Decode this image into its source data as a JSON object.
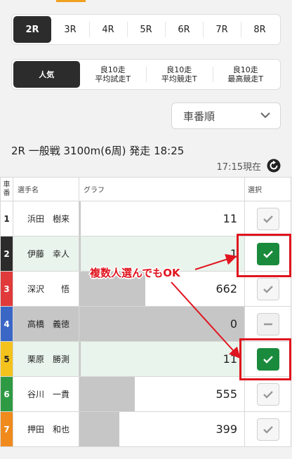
{
  "race_tabs": [
    {
      "label": "2R",
      "active": true
    },
    {
      "label": "3R"
    },
    {
      "label": "4R"
    },
    {
      "label": "5R"
    },
    {
      "label": "6R"
    },
    {
      "label": "7R"
    },
    {
      "label": "8R"
    }
  ],
  "sort_tabs": [
    {
      "label": "人気",
      "active": true
    },
    {
      "label": "良10走\n平均試走T"
    },
    {
      "label": "良10走\n平均競走T"
    },
    {
      "label": "良10走\n最高競走T"
    }
  ],
  "sort_select": {
    "value": "車番順"
  },
  "race_info": "2R 一般戦 3100m(6周) 発走 18:25",
  "now_label": "17:15現在",
  "table": {
    "headers": {
      "car": "車\n番",
      "rider": "選手名",
      "graph": "グラフ",
      "select": "選択"
    },
    "max_value": 662,
    "rows": [
      {
        "num": "1",
        "name": "浜田　樹来",
        "value": 11,
        "display": "11",
        "state": "unchecked",
        "color": "#ffffff",
        "num_color": "#222222"
      },
      {
        "num": "2",
        "name": "伊藤　幸人",
        "value": 1,
        "display": "1",
        "state": "checked",
        "color": "#2b2b2b",
        "num_color": "#ffffff"
      },
      {
        "num": "3",
        "name": "深沢　　悟",
        "value": 662,
        "display": "662",
        "state": "unchecked",
        "color": "#e03a3a",
        "num_color": "#ffffff"
      },
      {
        "num": "4",
        "name": "高橋　義徳",
        "value": 0,
        "display": "0",
        "state": "disabled",
        "color": "#3a66c6",
        "num_color": "#ffffff"
      },
      {
        "num": "5",
        "name": "栗原　勝測",
        "value": 11,
        "display": "11",
        "state": "checked",
        "color": "#f3c21c",
        "num_color": "#222222"
      },
      {
        "num": "6",
        "name": "谷川　一貴",
        "value": 555,
        "display": "555",
        "state": "unchecked",
        "color": "#2f9a44",
        "num_color": "#ffffff"
      },
      {
        "num": "7",
        "name": "押田　和也",
        "value": 399,
        "display": "399",
        "state": "unchecked",
        "color": "#f08a1c",
        "num_color": "#ffffff"
      }
    ]
  },
  "annotation": {
    "text": "複数人選んでもOK",
    "color": "#e0141e"
  },
  "icons": {
    "sort": "chevron-down-icon",
    "refresh": "refresh-icon",
    "check": "check-icon",
    "minus": "minus-icon"
  }
}
